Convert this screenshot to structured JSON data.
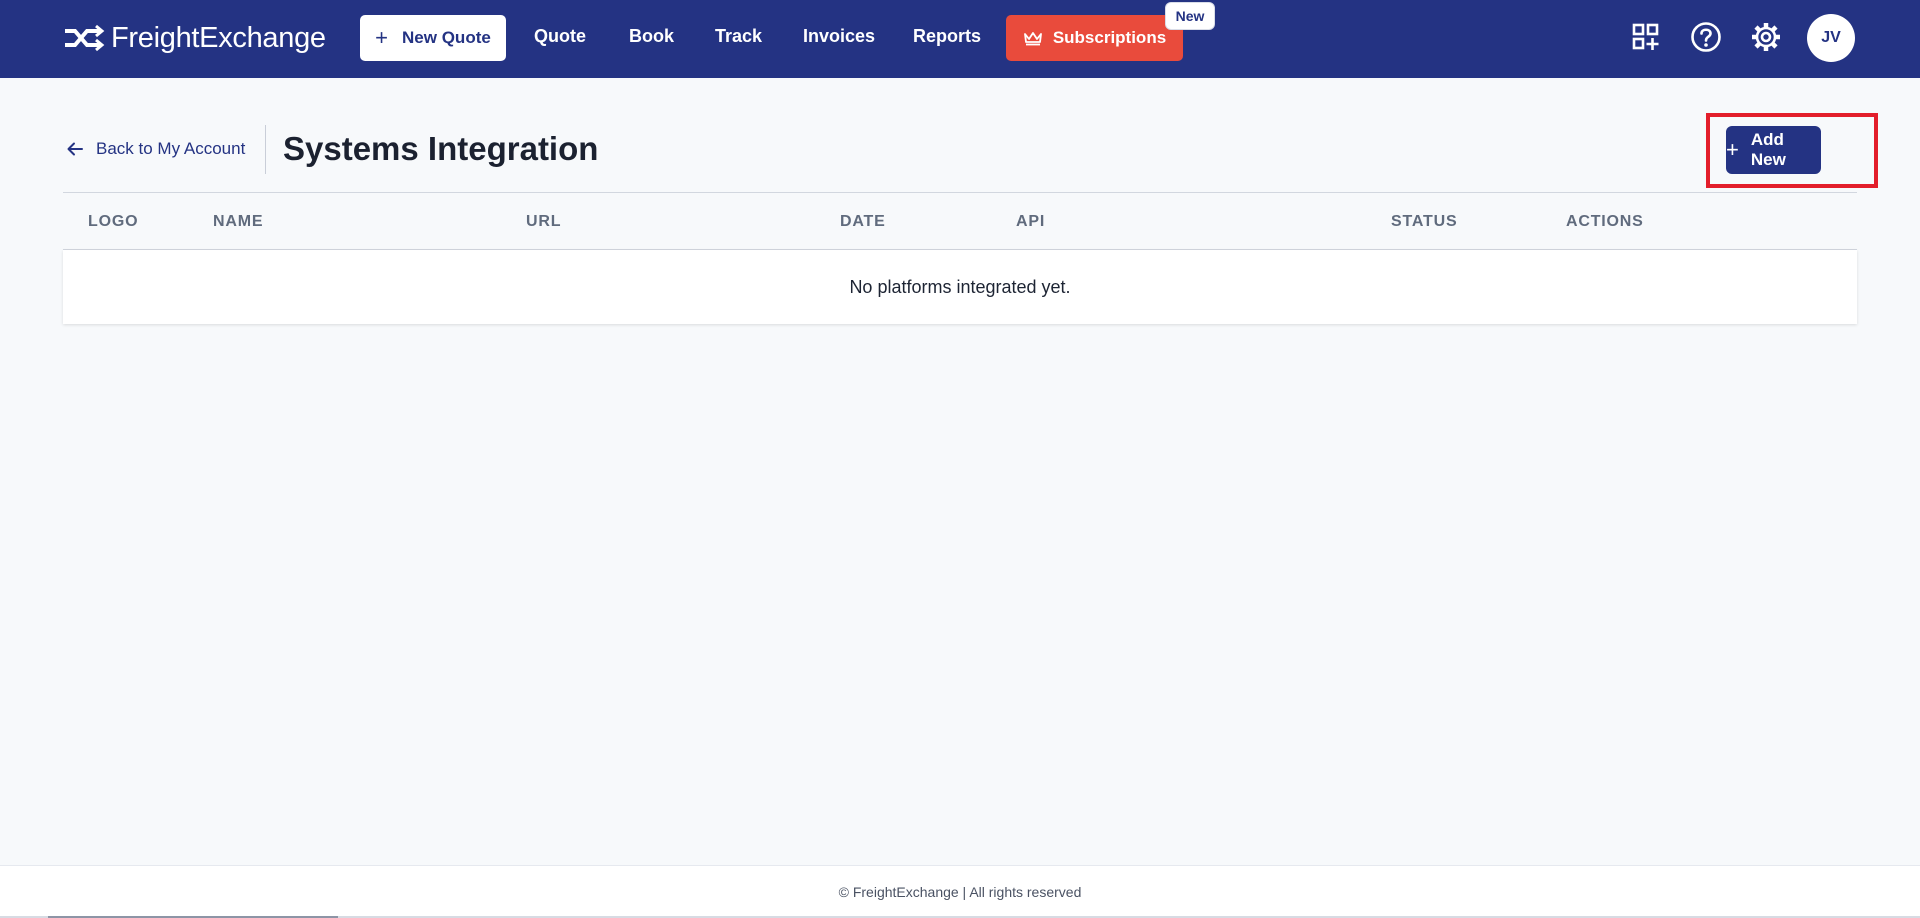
{
  "brand": {
    "name": "FreightExchange"
  },
  "nav": {
    "new_quote": "New Quote",
    "links": [
      "Quote",
      "Book",
      "Track",
      "Invoices",
      "Reports"
    ],
    "subscriptions": "Subscriptions",
    "new_badge": "New",
    "avatar_initials": "JV"
  },
  "page": {
    "back_link": "Back to My Account",
    "title": "Systems Integration",
    "add_new": "Add New"
  },
  "table": {
    "columns": [
      "LOGO",
      "NAME",
      "URL",
      "DATE",
      "API",
      "STATUS",
      "ACTIONS"
    ],
    "empty_message": "No platforms integrated yet."
  },
  "footer": {
    "text": "© FreightExchange | All rights reserved"
  },
  "colors": {
    "navbar": "#243383",
    "subscriptions": "#e94b3c",
    "highlight": "#e31e2b",
    "background": "#f7f9fb"
  },
  "icons": [
    "logo-icon",
    "plus-icon",
    "crown-icon",
    "apps-icon",
    "help-icon",
    "gear-icon",
    "arrow-left-icon"
  ]
}
